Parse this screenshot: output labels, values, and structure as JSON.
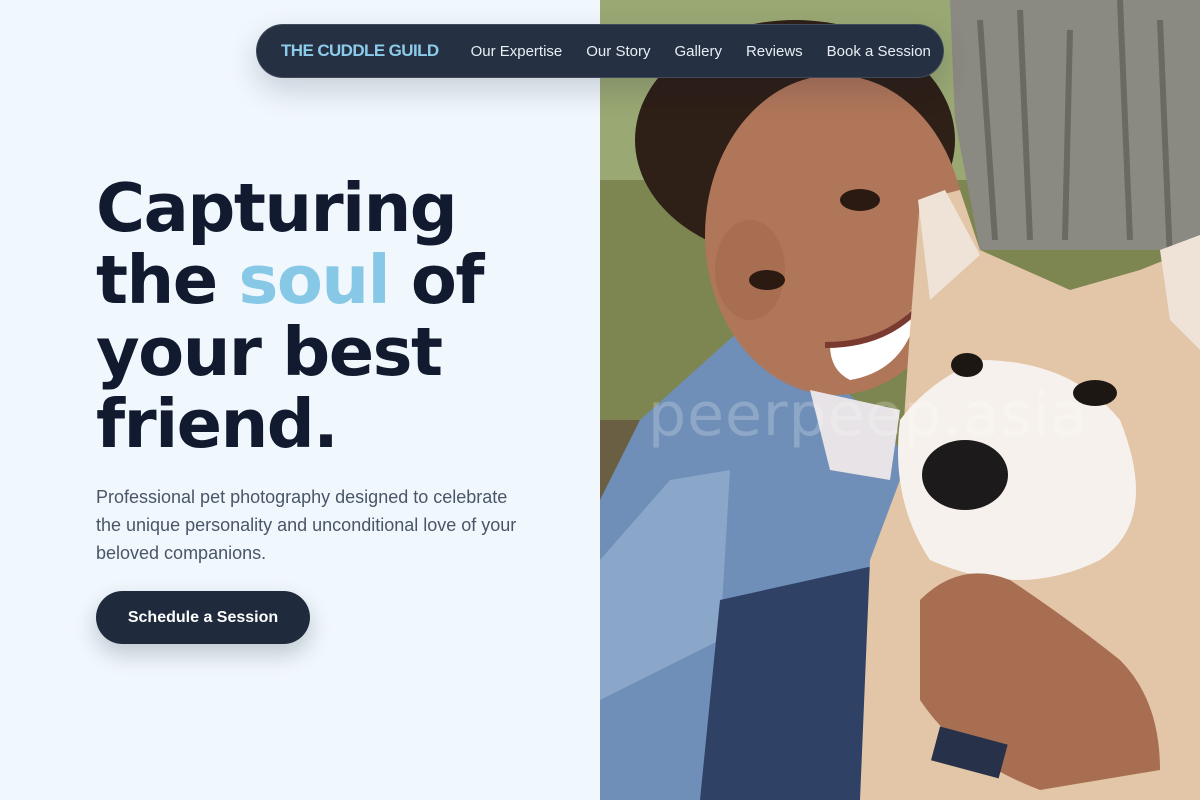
{
  "nav": {
    "brand": "THE CUDDLE GUILD",
    "links": [
      {
        "label": "Our Expertise"
      },
      {
        "label": "Our Story"
      },
      {
        "label": "Gallery"
      },
      {
        "label": "Reviews"
      },
      {
        "label": "Book a Session"
      }
    ]
  },
  "hero": {
    "headline_part1": "Capturing the ",
    "headline_accent": "soul",
    "headline_part2": " of your best friend.",
    "subtitle": "Professional pet photography designed to celebrate the unique personality and unconditional love of your beloved companions.",
    "cta_label": "Schedule a Session"
  },
  "photo": {
    "watermark": "peerpeep.asia"
  },
  "colors": {
    "accent": "#86c8e6",
    "brand": "#8ccbea",
    "nav_background": "#253043",
    "headline": "#111a2e",
    "page_background": "#f0f7fd"
  }
}
